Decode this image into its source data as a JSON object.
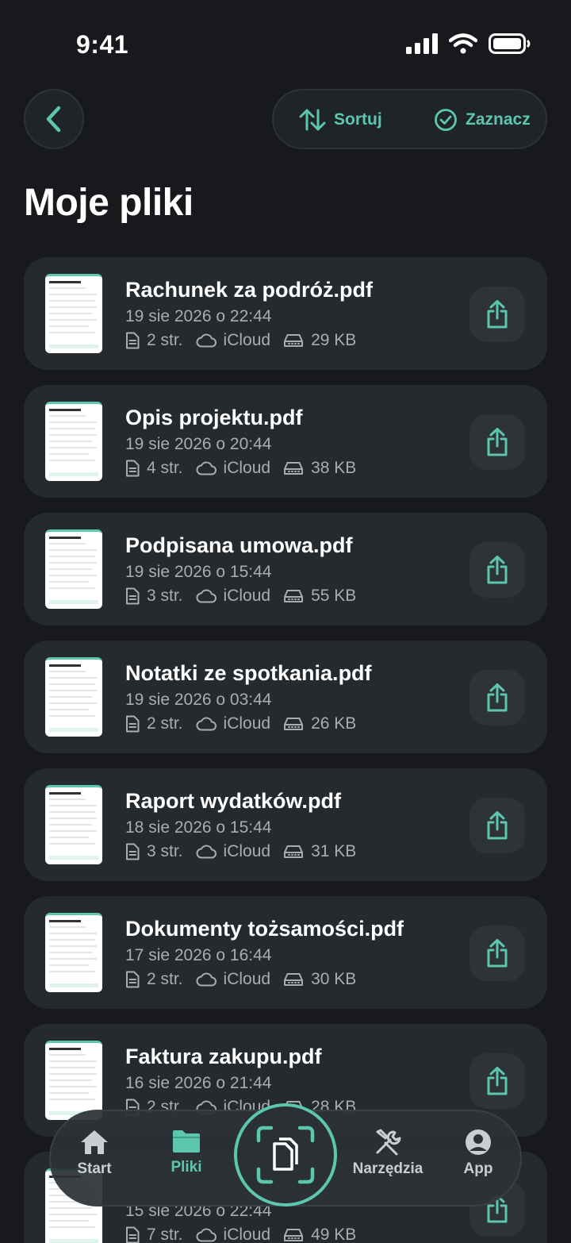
{
  "status": {
    "time": "9:41"
  },
  "header": {
    "title": "Moje pliki",
    "sort_label": "Sortuj",
    "select_label": "Zaznacz"
  },
  "files": [
    {
      "name": "Rachunek za podróż.pdf",
      "date": "19 sie 2026 o 22:44",
      "pages": "2 str.",
      "storage": "iCloud",
      "size": "29 KB"
    },
    {
      "name": "Opis projektu.pdf",
      "date": "19 sie 2026 o 20:44",
      "pages": "4 str.",
      "storage": "iCloud",
      "size": "38 KB"
    },
    {
      "name": "Podpisana umowa.pdf",
      "date": "19 sie 2026 o 15:44",
      "pages": "3 str.",
      "storage": "iCloud",
      "size": "55 KB"
    },
    {
      "name": "Notatki ze spotkania.pdf",
      "date": "19 sie 2026 o 03:44",
      "pages": "2 str.",
      "storage": "iCloud",
      "size": "26 KB"
    },
    {
      "name": "Raport wydatków.pdf",
      "date": "18 sie 2026 o 15:44",
      "pages": "3 str.",
      "storage": "iCloud",
      "size": "31 KB"
    },
    {
      "name": "Dokumenty tożsamości.pdf",
      "date": "17 sie 2026 o 16:44",
      "pages": "2 str.",
      "storage": "iCloud",
      "size": "30 KB"
    },
    {
      "name": "Faktura zakupu.pdf",
      "date": "16 sie 2026 o 21:44",
      "pages": "2 str.",
      "storage": "iCloud",
      "size": "28 KB"
    },
    {
      "name": "",
      "date": "15 sie 2026 o 22:44",
      "pages": "7 str.",
      "storage": "iCloud",
      "size": "49 KB"
    }
  ],
  "nav": {
    "start": "Start",
    "files": "Pliki",
    "tools": "Narzędzia",
    "app": "App"
  },
  "colors": {
    "accent": "#5cc6ae",
    "background": "#17191c",
    "card": "#252a2e"
  }
}
